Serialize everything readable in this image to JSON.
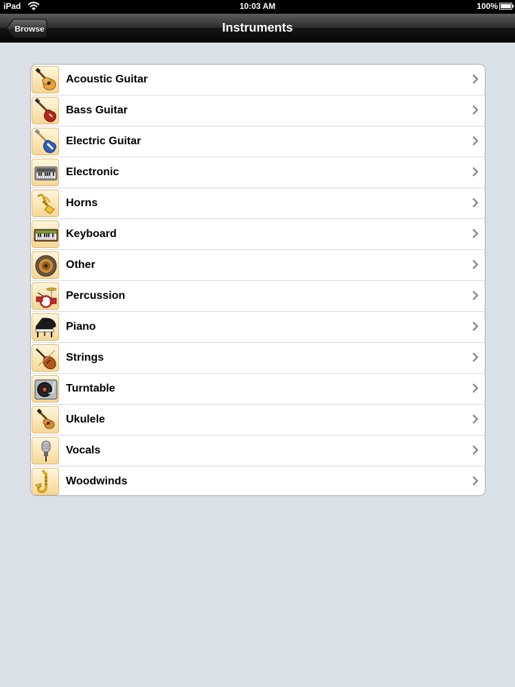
{
  "status_bar": {
    "carrier": "iPad",
    "time": "10:03 AM",
    "battery": "100%",
    "battery_level": 1.0,
    "wifi_icon": "wifi-icon"
  },
  "nav": {
    "title": "Instruments",
    "back_label": "Browse"
  },
  "colors": {
    "nav_bar": "#1a1a1a",
    "background": "#d9e0e6",
    "icon_tile": "#f6d795",
    "chevron": "#8c8c8c"
  },
  "rows": [
    {
      "label": "Acoustic Guitar",
      "icon": "acoustic-guitar-icon"
    },
    {
      "label": "Bass Guitar",
      "icon": "bass-guitar-icon"
    },
    {
      "label": "Electric Guitar",
      "icon": "electric-guitar-icon"
    },
    {
      "label": "Electronic",
      "icon": "synthesizer-icon"
    },
    {
      "label": "Horns",
      "icon": "trumpet-icon"
    },
    {
      "label": "Keyboard",
      "icon": "keyboard-icon"
    },
    {
      "label": "Other",
      "icon": "speaker-icon"
    },
    {
      "label": "Percussion",
      "icon": "drum-kit-icon"
    },
    {
      "label": "Piano",
      "icon": "grand-piano-icon"
    },
    {
      "label": "Strings",
      "icon": "violin-icon"
    },
    {
      "label": "Turntable",
      "icon": "turntable-icon"
    },
    {
      "label": "Ukulele",
      "icon": "ukulele-icon"
    },
    {
      "label": "Vocals",
      "icon": "microphone-icon"
    },
    {
      "label": "Woodwinds",
      "icon": "saxophone-icon"
    }
  ]
}
